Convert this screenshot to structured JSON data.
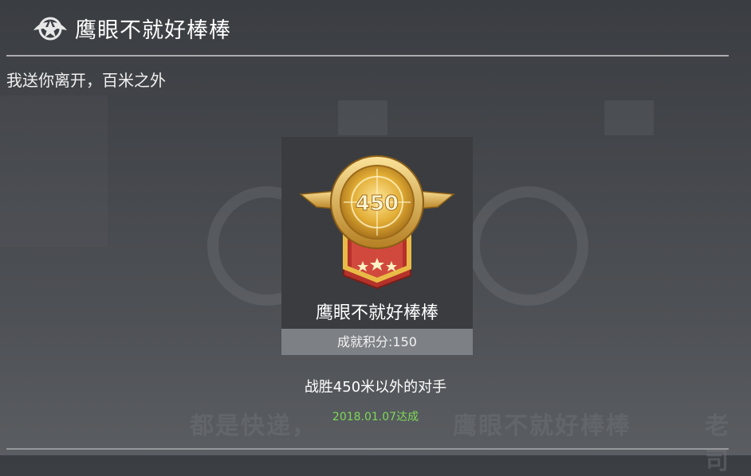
{
  "header": {
    "title": "鹰眼不就好棒棒",
    "icon": "wings-star-icon"
  },
  "subtitle": "我送你离开，百米之外",
  "medal_card": {
    "medal_number": "450",
    "name": "鹰眼不就好棒棒",
    "score_label": "成就积分:150",
    "colors": {
      "gold": "#e7b43a",
      "ribbon": "#c0392b"
    }
  },
  "description": "战胜450米以外的对手",
  "achieved_date": "2018.01.07达成",
  "background_text": {
    "left": "都是快递，",
    "right": "鹰眼不就好棒棒",
    "far_right": "老司"
  }
}
